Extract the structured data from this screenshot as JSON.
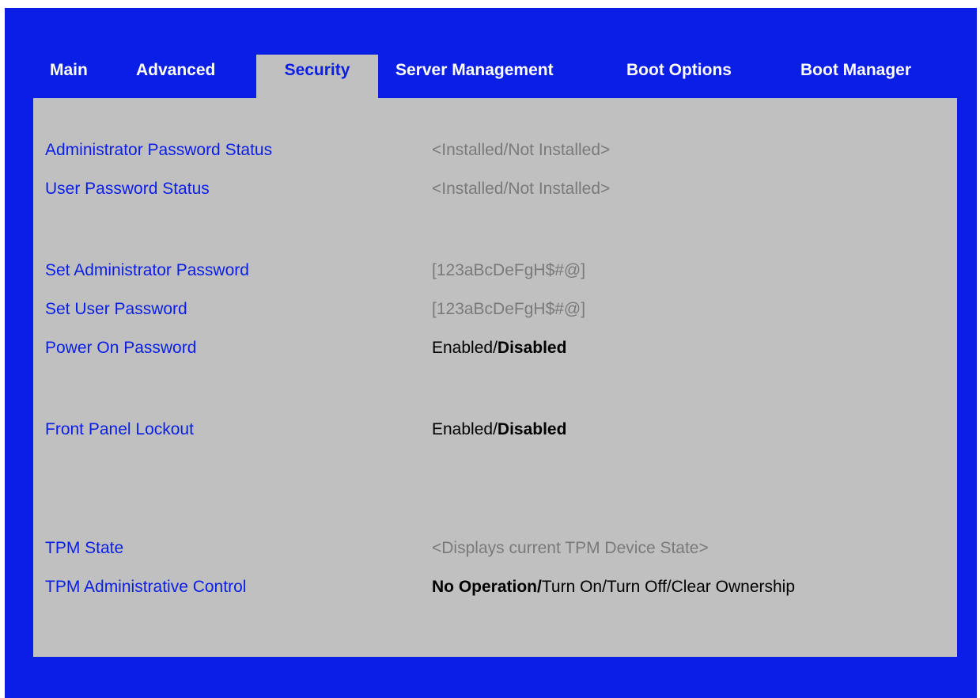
{
  "tabs": [
    {
      "label": "Main"
    },
    {
      "label": "Advanced"
    },
    {
      "label": "Security",
      "active": true
    },
    {
      "label": "Server Management"
    },
    {
      "label": "Boot Options"
    },
    {
      "label": "Boot Manager"
    }
  ],
  "settings": {
    "admin_password_status": {
      "label": "Administrator Password Status",
      "value": "<Installed/Not Installed>"
    },
    "user_password_status": {
      "label": "User Password Status",
      "value": "<Installed/Not Installed>"
    },
    "set_admin_password": {
      "label": "Set Administrator Password",
      "value": "[123aBcDeFgH$#@]"
    },
    "set_user_password": {
      "label": "Set User Password",
      "value": "[123aBcDeFgH$#@]"
    },
    "power_on_password": {
      "label": "Power On Password",
      "value_plain": "Enabled/",
      "value_bold": "Disabled"
    },
    "front_panel_lockout": {
      "label": "Front Panel Lockout",
      "value_plain": "Enabled/",
      "value_bold": "Disabled"
    },
    "tpm_state": {
      "label": "TPM State",
      "value": "<Displays current TPM Device State>"
    },
    "tpm_admin_control": {
      "label": "TPM Administrative Control",
      "value_bold": "No Operation/",
      "value_plain": "Turn On/Turn Off/Clear Ownership"
    }
  },
  "colors": {
    "background": "#0a1ee6",
    "panel": "#c0c0c0",
    "label": "#0a1ee6",
    "info_value": "#7a7a7a",
    "option_value": "#000000"
  }
}
